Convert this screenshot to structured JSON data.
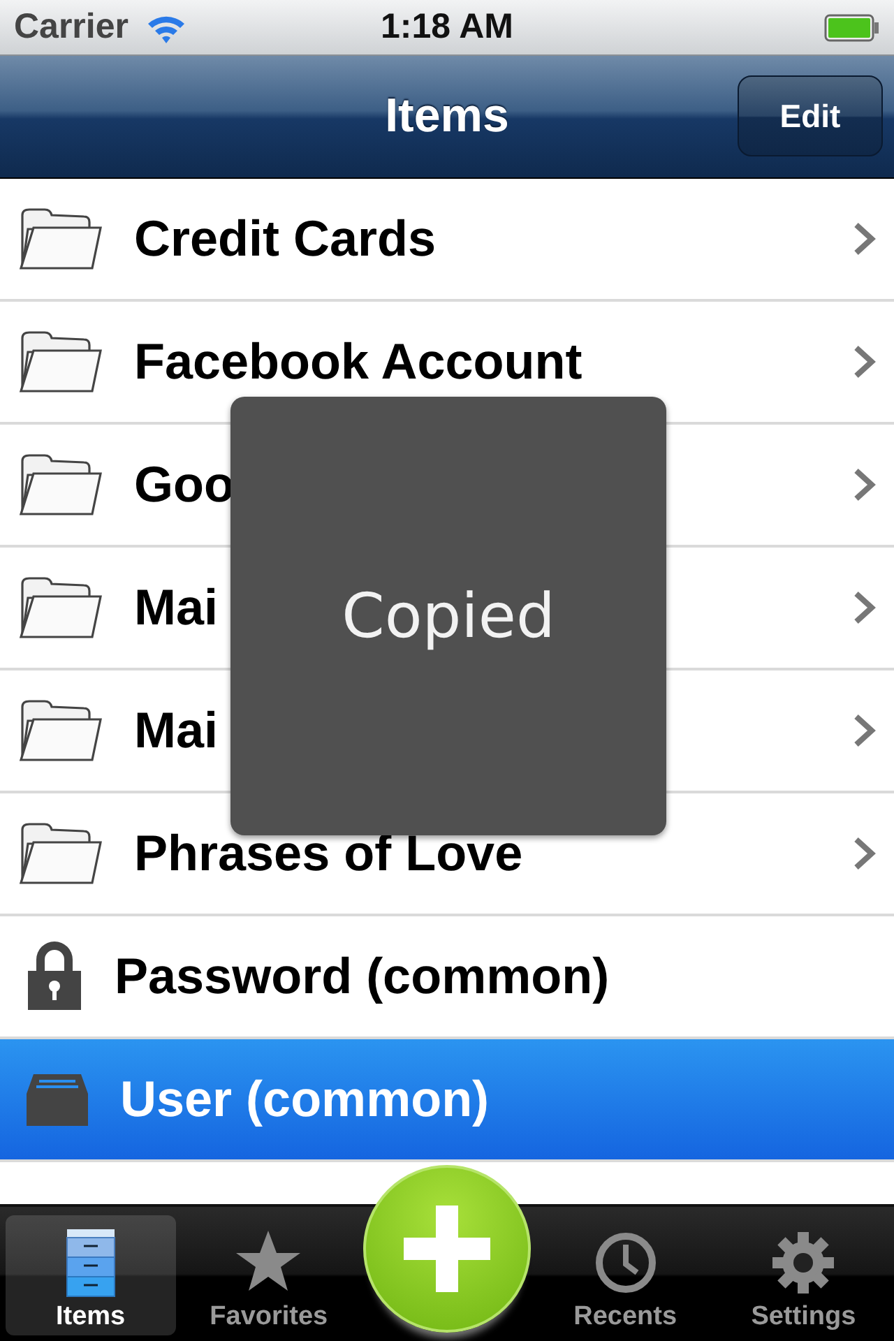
{
  "status_bar": {
    "carrier": "Carrier",
    "time": "1:18 AM"
  },
  "nav_bar": {
    "title": "Items",
    "edit_button": "Edit"
  },
  "items": [
    {
      "kind": "folder",
      "label": "Credit Cards",
      "selected": false
    },
    {
      "kind": "folder",
      "label": "Facebook Account",
      "selected": false
    },
    {
      "kind": "folder",
      "label": "Goo",
      "selected": false
    },
    {
      "kind": "folder",
      "label": "Mai",
      "selected": false
    },
    {
      "kind": "folder",
      "label": "Mai",
      "selected": false
    },
    {
      "kind": "folder",
      "label": "Phrases of Love",
      "selected": false
    },
    {
      "kind": "lock",
      "label": "Password (common)",
      "selected": false
    },
    {
      "kind": "box",
      "label": "User (common)",
      "selected": true
    }
  ],
  "toast": "Copied",
  "tab_bar": [
    {
      "kind": "items",
      "label": "Items",
      "selected": true
    },
    {
      "kind": "favorites",
      "label": "Favorites",
      "selected": false
    },
    {
      "kind": "add"
    },
    {
      "kind": "recents",
      "label": "Recents",
      "selected": false
    },
    {
      "kind": "settings",
      "label": "Settings",
      "selected": false
    }
  ]
}
